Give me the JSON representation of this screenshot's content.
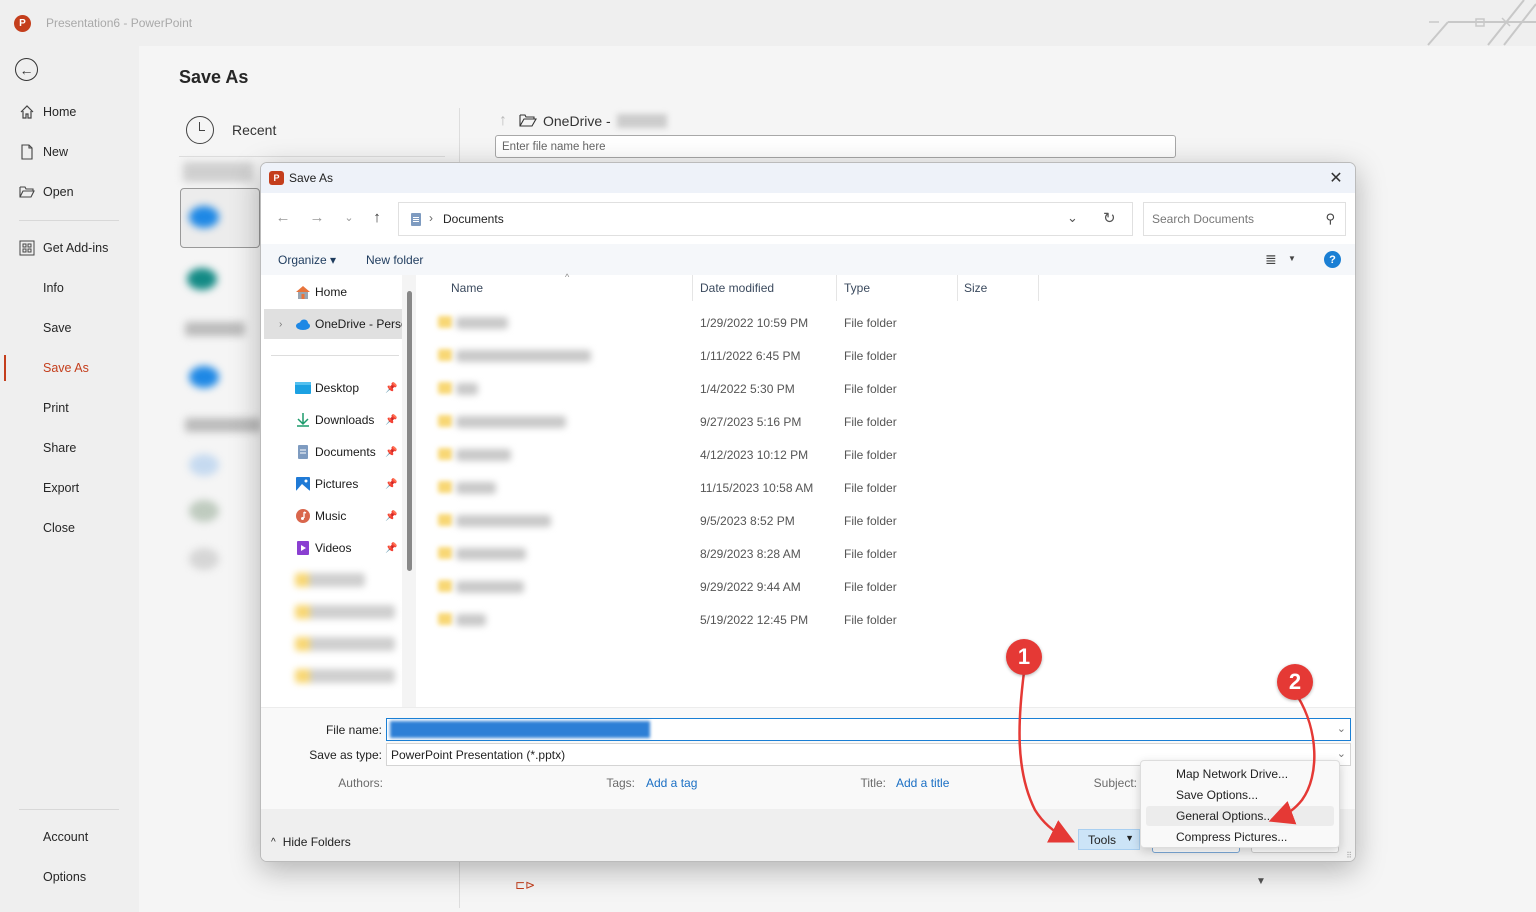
{
  "window": {
    "app_logo": "P",
    "title": "Presentation6  -  PowerPoint"
  },
  "nav": {
    "back_icon": "back-arrow-icon",
    "items": [
      {
        "label": "Home",
        "icon": "home-icon"
      },
      {
        "label": "New",
        "icon": "new-document-icon"
      },
      {
        "label": "Open",
        "icon": "open-folder-icon"
      },
      {
        "label": "Get Add-ins",
        "icon": "add-ins-grid-icon"
      },
      {
        "label": "Info"
      },
      {
        "label": "Save"
      },
      {
        "label": "Save As",
        "active": true
      },
      {
        "label": "Print"
      },
      {
        "label": "Share"
      },
      {
        "label": "Export"
      },
      {
        "label": "Close"
      },
      {
        "label": "Account"
      },
      {
        "label": "Options"
      }
    ],
    "accent_color": "#c43e1c"
  },
  "backstage": {
    "page_title": "Save As",
    "recent_label": "Recent",
    "location_path": "OneDrive -",
    "file_name_placeholder": "Enter file name here"
  },
  "dialog": {
    "title": "Save As",
    "close_icon": "close-icon",
    "address": {
      "crumb": "Documents",
      "separator": "›"
    },
    "search_placeholder": "Search Documents",
    "toolbar": {
      "organize": "Organize ▾",
      "new_folder": "New folder",
      "help": "?"
    },
    "tree": [
      {
        "label": "Home",
        "icon": "home-icon"
      },
      {
        "label": "OneDrive - Perso",
        "icon": "onedrive-cloud-icon",
        "selected": true,
        "expandable": true
      },
      {
        "label": "Desktop",
        "icon": "desktop-icon",
        "pinned": true
      },
      {
        "label": "Downloads",
        "icon": "download-icon",
        "pinned": true
      },
      {
        "label": "Documents",
        "icon": "documents-icon",
        "pinned": true
      },
      {
        "label": "Pictures",
        "icon": "pictures-icon",
        "pinned": true
      },
      {
        "label": "Music",
        "icon": "music-icon",
        "pinned": true
      },
      {
        "label": "Videos",
        "icon": "videos-icon",
        "pinned": true
      }
    ],
    "columns": [
      "Name",
      "Date modified",
      "Type",
      "Size"
    ],
    "rows": [
      {
        "date": "1/29/2022 10:59 PM",
        "type": "File folder"
      },
      {
        "date": "1/11/2022 6:45 PM",
        "type": "File folder"
      },
      {
        "date": "1/4/2022 5:30 PM",
        "type": "File folder"
      },
      {
        "date": "9/27/2023 5:16 PM",
        "type": "File folder"
      },
      {
        "date": "4/12/2023 10:12 PM",
        "type": "File folder"
      },
      {
        "date": "11/15/2023 10:58 AM",
        "type": "File folder"
      },
      {
        "date": "9/5/2023 8:52 PM",
        "type": "File folder"
      },
      {
        "date": "8/29/2023 8:28 AM",
        "type": "File folder"
      },
      {
        "date": "9/29/2022 9:44 AM",
        "type": "File folder"
      },
      {
        "date": "5/19/2022 12:45 PM",
        "type": "File folder"
      }
    ],
    "form": {
      "file_name_label": "File name:",
      "save_type_label": "Save as type:",
      "save_type_value": "PowerPoint Presentation (*.pptx)",
      "authors_label": "Authors:",
      "tags_label": "Tags:",
      "tags_link": "Add a tag",
      "title_label": "Title:",
      "title_link": "Add a title",
      "subject_label": "Subject:"
    },
    "footer": {
      "hide_folders": "Hide Folders",
      "tools": "Tools"
    },
    "tools_menu": [
      {
        "label": "Map Network Drive..."
      },
      {
        "label": "Save Options..."
      },
      {
        "label": "General Options...",
        "highlighted": true
      },
      {
        "label": "Compress Pictures..."
      }
    ]
  },
  "annotations": {
    "badges": [
      "1",
      "2"
    ],
    "color": "#e53935"
  }
}
